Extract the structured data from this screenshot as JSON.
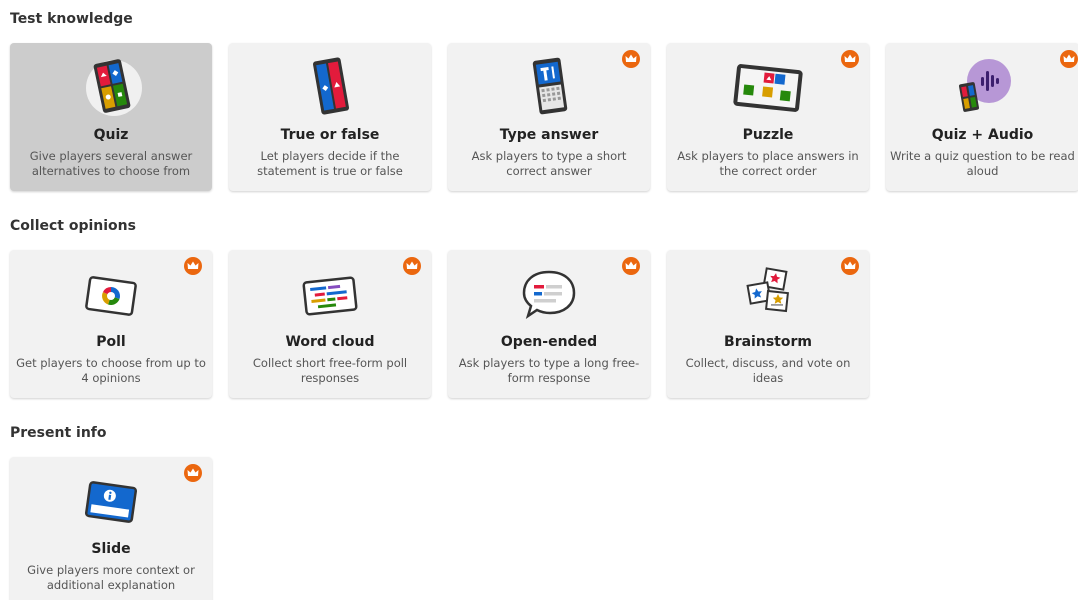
{
  "colors": {
    "premium_badge": "#eb670f",
    "card_bg": "#f2f2f2",
    "card_selected_bg": "#cccccc",
    "red": "#e21b3c",
    "blue": "#1368ce",
    "yellow": "#d89e00",
    "green": "#26890c",
    "purple": "#864cbf"
  },
  "sections": {
    "test_knowledge": {
      "title": "Test knowledge",
      "cards": [
        {
          "label": "Quiz",
          "desc": "Give players several answer alternatives to choose from",
          "icon": "quiz-icon",
          "premium": false,
          "selected": true
        },
        {
          "label": "True or false",
          "desc": "Let players decide if the statement is true or false",
          "icon": "true-false-icon",
          "premium": false
        },
        {
          "label": "Type answer",
          "desc": "Ask players to type a short correct answer",
          "icon": "type-answer-icon",
          "premium": true
        },
        {
          "label": "Puzzle",
          "desc": "Ask players to place answers in the correct order",
          "icon": "puzzle-icon",
          "premium": true
        },
        {
          "label": "Quiz + Audio",
          "desc": "Write a quiz question to be read aloud",
          "icon": "quiz-audio-icon",
          "premium": true
        }
      ]
    },
    "collect_opinions": {
      "title": "Collect opinions",
      "cards": [
        {
          "label": "Poll",
          "desc": "Get players to choose from up to 4 opinions",
          "icon": "poll-icon",
          "premium": true
        },
        {
          "label": "Word cloud",
          "desc": "Collect short free-form poll responses",
          "icon": "word-cloud-icon",
          "premium": true
        },
        {
          "label": "Open-ended",
          "desc": "Ask players to type a long free-form response",
          "icon": "open-ended-icon",
          "premium": true
        },
        {
          "label": "Brainstorm",
          "desc": "Collect, discuss, and vote on ideas",
          "icon": "brainstorm-icon",
          "premium": true
        }
      ]
    },
    "present_info": {
      "title": "Present info",
      "cards": [
        {
          "label": "Slide",
          "desc": "Give players more context or additional explanation",
          "icon": "slide-icon",
          "premium": true
        }
      ]
    }
  }
}
